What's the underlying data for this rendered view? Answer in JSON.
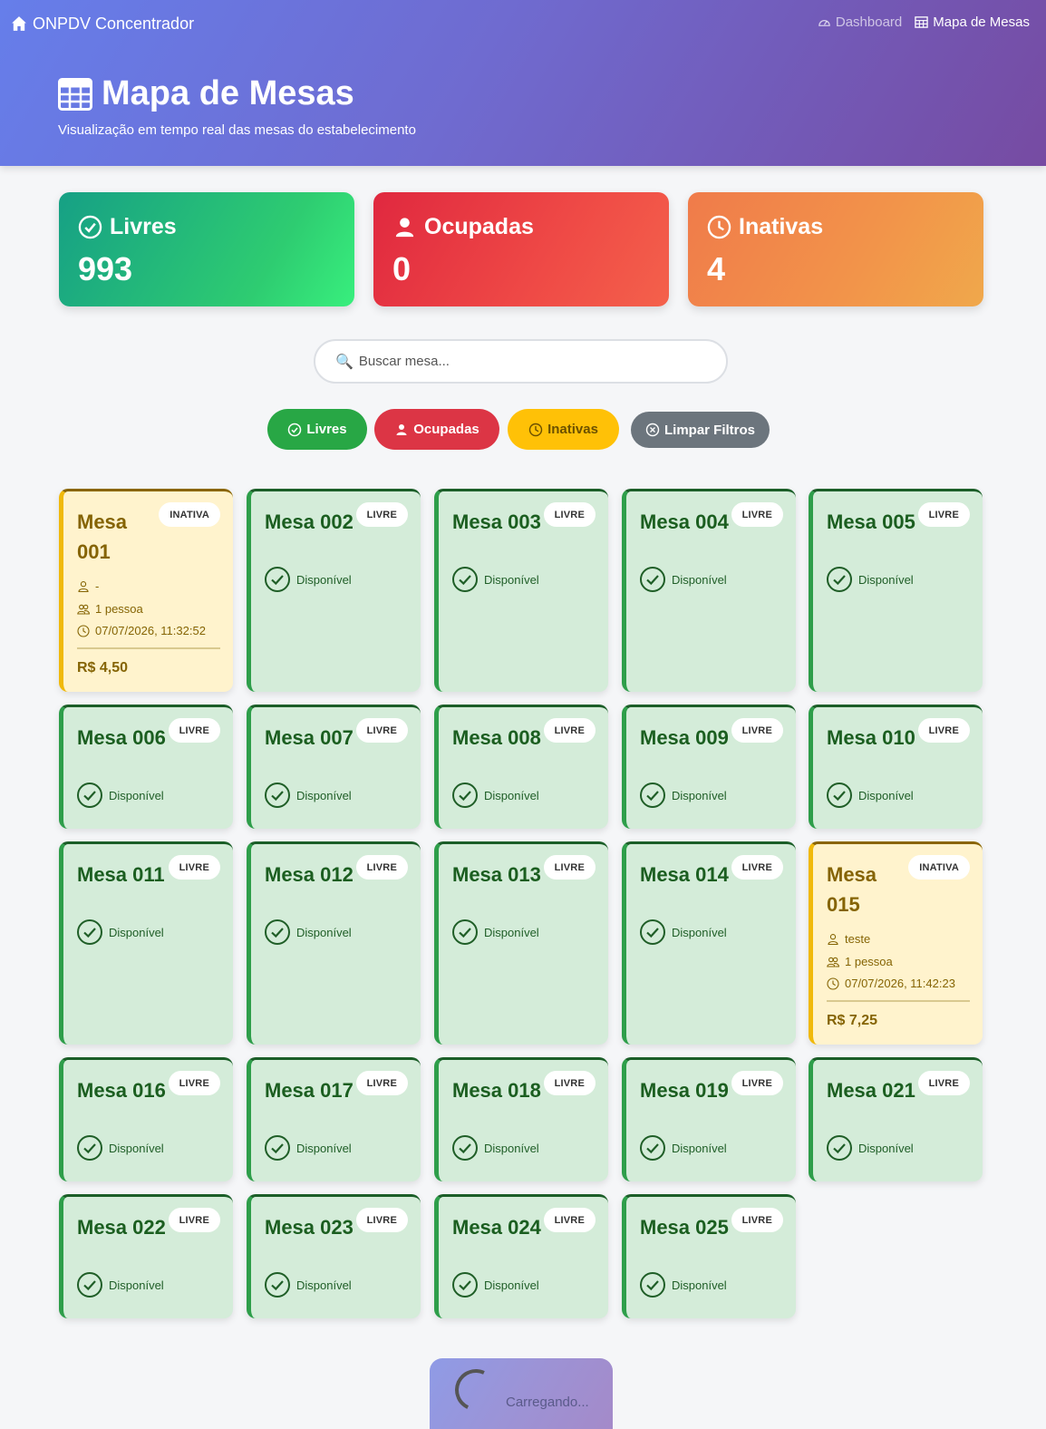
{
  "app": {
    "brand": "ONPDV Concentrador"
  },
  "nav": [
    {
      "label": "Dashboard",
      "icon": "gauge-icon",
      "active": false
    },
    {
      "label": "Mapa de Mesas",
      "icon": "table-grid-icon",
      "active": true
    }
  ],
  "header": {
    "title": "Mapa de Mesas",
    "subtitle": "Visualização em tempo real das mesas do estabelecimento"
  },
  "stats": {
    "livres": {
      "label": "Livres",
      "value": "993"
    },
    "ocupadas": {
      "label": "Ocupadas",
      "value": "0"
    },
    "inativas": {
      "label": "Inativas",
      "value": "4"
    }
  },
  "search": {
    "placeholder": "Buscar mesa...",
    "value": ""
  },
  "filters": {
    "livres": "Livres",
    "ocupadas": "Ocupadas",
    "inativas": "Inativas",
    "limpar": "Limpar Filtros"
  },
  "colors": {
    "livre_bg": "#d4ecd9",
    "inativa_bg": "#fff3cd",
    "livre_accent": "#2e9e4a",
    "inativa_accent": "#f0b90b"
  },
  "mesas": [
    {
      "name": "Mesa 001",
      "status": "inativa",
      "badge": "INATIVA",
      "cliente": "-",
      "pessoas": "1 pessoa",
      "horario": "07/07/2026, 11:32:52",
      "valor": "R$ 4,50"
    },
    {
      "name": "Mesa 002",
      "status": "livre",
      "badge": "LIVRE",
      "status_text": "Disponível"
    },
    {
      "name": "Mesa 003",
      "status": "livre",
      "badge": "LIVRE",
      "status_text": "Disponível"
    },
    {
      "name": "Mesa 004",
      "status": "livre",
      "badge": "LIVRE",
      "status_text": "Disponível"
    },
    {
      "name": "Mesa 005",
      "status": "livre",
      "badge": "LIVRE",
      "status_text": "Disponível"
    },
    {
      "name": "Mesa 006",
      "status": "livre",
      "badge": "LIVRE",
      "status_text": "Disponível"
    },
    {
      "name": "Mesa 007",
      "status": "livre",
      "badge": "LIVRE",
      "status_text": "Disponível"
    },
    {
      "name": "Mesa 008",
      "status": "livre",
      "badge": "LIVRE",
      "status_text": "Disponível"
    },
    {
      "name": "Mesa 009",
      "status": "livre",
      "badge": "LIVRE",
      "status_text": "Disponível"
    },
    {
      "name": "Mesa 010",
      "status": "livre",
      "badge": "LIVRE",
      "status_text": "Disponível"
    },
    {
      "name": "Mesa 011",
      "status": "livre",
      "badge": "LIVRE",
      "status_text": "Disponível"
    },
    {
      "name": "Mesa 012",
      "status": "livre",
      "badge": "LIVRE",
      "status_text": "Disponível"
    },
    {
      "name": "Mesa 013",
      "status": "livre",
      "badge": "LIVRE",
      "status_text": "Disponível"
    },
    {
      "name": "Mesa 014",
      "status": "livre",
      "badge": "LIVRE",
      "status_text": "Disponível"
    },
    {
      "name": "Mesa 015",
      "status": "inativa",
      "badge": "INATIVA",
      "cliente": "teste",
      "pessoas": "1 pessoa",
      "horario": "07/07/2026, 11:42:23",
      "valor": "R$ 7,25"
    },
    {
      "name": "Mesa 016",
      "status": "livre",
      "badge": "LIVRE",
      "status_text": "Disponível"
    },
    {
      "name": "Mesa 017",
      "status": "livre",
      "badge": "LIVRE",
      "status_text": "Disponível"
    },
    {
      "name": "Mesa 018",
      "status": "livre",
      "badge": "LIVRE",
      "status_text": "Disponível"
    },
    {
      "name": "Mesa 019",
      "status": "livre",
      "badge": "LIVRE",
      "status_text": "Disponível"
    },
    {
      "name": "Mesa 021",
      "status": "livre",
      "badge": "LIVRE",
      "status_text": "Disponível"
    },
    {
      "name": "Mesa 022",
      "status": "livre",
      "badge": "LIVRE",
      "status_text": "Disponível"
    },
    {
      "name": "Mesa 023",
      "status": "livre",
      "badge": "LIVRE",
      "status_text": "Disponível"
    },
    {
      "name": "Mesa 024",
      "status": "livre",
      "badge": "LIVRE",
      "status_text": "Disponível"
    },
    {
      "name": "Mesa 025",
      "status": "livre",
      "badge": "LIVRE",
      "status_text": "Disponível"
    }
  ],
  "loading": {
    "label": "Carregando..."
  }
}
